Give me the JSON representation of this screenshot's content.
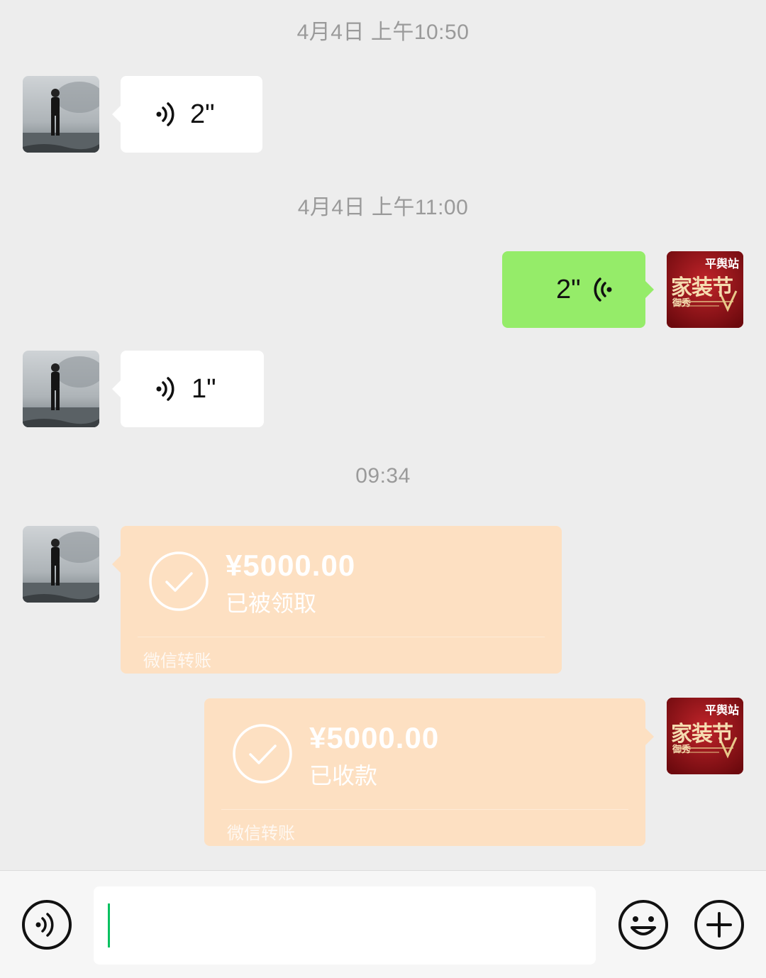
{
  "timestamps": [
    "4月4日 上午10:50",
    "4月4日 上午11:00",
    "09:34"
  ],
  "messages": {
    "voice_in_1": {
      "duration": "2\""
    },
    "voice_out_1": {
      "duration": "2\""
    },
    "voice_in_2": {
      "duration": "1\""
    },
    "transfer_in": {
      "amount": "¥5000.00",
      "status": "已被领取",
      "footer": "微信转账"
    },
    "transfer_out": {
      "amount": "¥5000.00",
      "status": "已收款",
      "footer": "微信转账"
    }
  },
  "self_avatar": {
    "line1": "平舆站",
    "line2": "家装节",
    "line3": "御秀"
  },
  "input": {
    "value": ""
  },
  "icons": {
    "voice_message": "voice-wave-icon",
    "voice_toggle": "voice-mode-icon",
    "emoji": "emoji-icon",
    "more": "plus-icon",
    "transfer_check": "check-circle-icon"
  },
  "colors": {
    "background": "#ededed",
    "incoming_bubble": "#ffffff",
    "outgoing_bubble": "#95ec69",
    "transfer_bubble": "#fde0c2",
    "caret": "#07c160",
    "timestamp_text": "#9a9a9a"
  }
}
